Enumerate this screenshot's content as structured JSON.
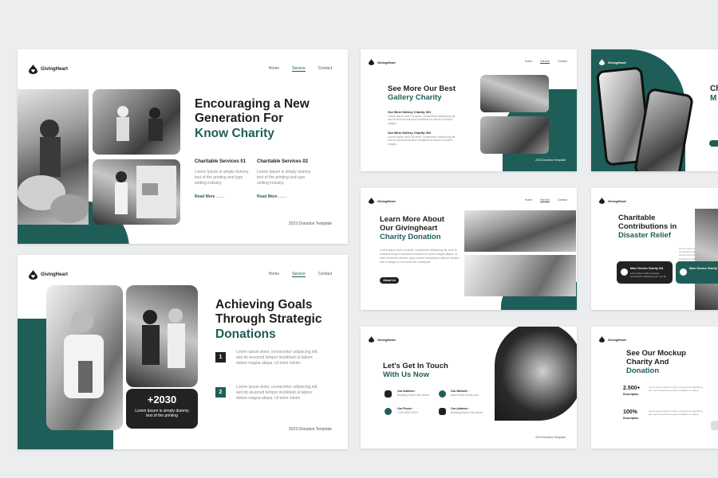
{
  "brand": "GivingHeart",
  "nav": [
    "Home",
    "Service",
    "Contact"
  ],
  "footer": "2023 Donation Template",
  "slide1": {
    "title_lines": [
      "Encouraging a New",
      "Generation For"
    ],
    "title_accent": "Know Charity",
    "services": [
      {
        "title": "Charitable Services 01",
        "body": "Lorem Ipsum is simply dummy text of the printing and type setting industry.",
        "link": "Read More . . . ."
      },
      {
        "title": "Charitable Services 02",
        "body": "Lorem Ipsum is simply dummy text of the printing and type setting industry.",
        "link": "Read More . . . ."
      }
    ]
  },
  "slide2": {
    "title_lines": [
      "Achieving Goals",
      "Through Strategic"
    ],
    "title_accent": "Donations",
    "stat_value": "+2030",
    "stat_caption": "Lorem Ipsum is simply dummy text of the printing",
    "points": [
      {
        "num": "1",
        "text": "Lorem ipsum dolor, consectetur adipiscing elit, sed do eiusmod tempor incididunt ut labore dolore magna aliqua. Ut enim minim."
      },
      {
        "num": "2",
        "text": "Lorem ipsum dolor, consectetur adipiscing elit, sed do eiusmod tempor incididunt ut labore dolore magna aliqua. Ut enim minim."
      }
    ]
  },
  "slide3": {
    "title_lines": [
      "See More Our Best"
    ],
    "title_accent": "Gallery Charity",
    "items": [
      {
        "title": "Our Best Gallery Charity 001",
        "body": "Lorem ipsum dolor sit amet, consectetur adipiscing elit, sed do eiusmod tempor incididunt ut labore et dolore magna."
      },
      {
        "title": "Our Best Gallery Charity 002",
        "body": "Lorem ipsum dolor sit amet, consectetur adipiscing elit, sed do eiusmod tempor incididunt ut labore et dolore magna."
      }
    ]
  },
  "slide5": {
    "title_lines": [
      "Learn More About",
      "Our Givingheart"
    ],
    "title_accent": "Charity Donation",
    "body": "Lorem ipsum dolor sit amet, consectetur adipiscing elit, sed do eiusmod tempor incididunt ut labore et dolore magna aliqua. Ut enim ad minim veniam, quis nostrud exercitation ullamco laboris nisi ut aliquip ex ea commodo consequat.",
    "button": "About Us"
  },
  "slide6": {
    "title_lines": [
      "Charitable",
      "Contributions in"
    ],
    "title_accent": "Disaster Relief",
    "body": "Lorem ipsum dolor sit amet, consectetur adipiscing elit, sed do eiusmod tempor incididunt ut labore et dolore magna aliqua.",
    "card1_title": "More Service Charity 001",
    "card1_body": "Lorem ipsum dolor sit amet, consectetur adipiscing elit, sed do",
    "card2_title": "More Service Charity"
  },
  "slide7": {
    "title_lines": [
      "Let's Get In Touch"
    ],
    "title_accent": "With Us Now",
    "contacts": [
      {
        "label": "Our Address :",
        "value": "Building Name City Name"
      },
      {
        "label": "Our Website :",
        "value": "www.HelloCharity.com"
      },
      {
        "label": "Our Phone :",
        "value": "+123-4567-8910"
      },
      {
        "label": "Our Address :",
        "value": "Building Name City Name"
      }
    ]
  },
  "slide8": {
    "title_lines": [
      "See Our Mockup",
      "Charity And"
    ],
    "title_accent": "Donation",
    "stats": [
      {
        "value": "2.500+",
        "label": "Description",
        "body": "Lorem ipsum dolor sit amet, consectetur adipiscing elit, sed do eiusmod tempor incididunt ut labore."
      },
      {
        "value": "100%",
        "label": "Description",
        "body": "Lorem ipsum dolor sit amet, consectetur adipiscing elit, sed do eiusmod tempor incididunt ut labore."
      }
    ]
  },
  "slide4": {
    "partial_title": "Ch",
    "partial_title2": "M"
  }
}
